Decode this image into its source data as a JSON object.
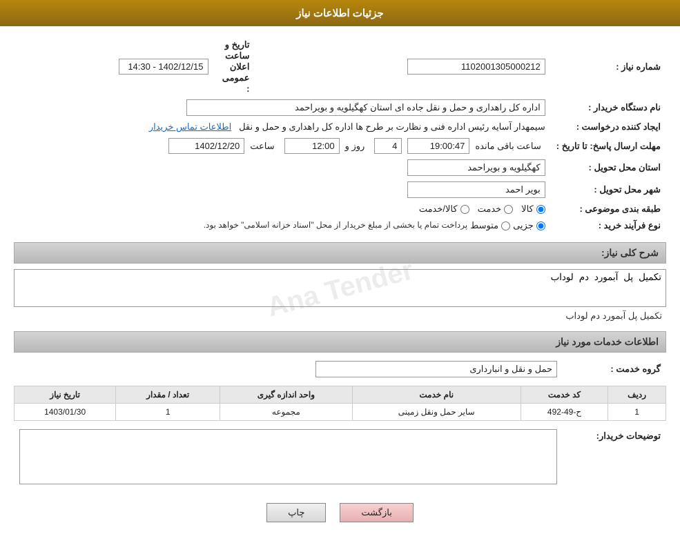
{
  "header": {
    "title": "جزئیات اطلاعات نیاز"
  },
  "fields": {
    "shomara_niaz_label": "شماره نیاز :",
    "shomara_niaz_value": "1102001305000212",
    "name_dastgah_label": "نام دستگاه خریدار :",
    "name_dastgah_value": "اداره کل راهداری و حمل و نقل جاده ای استان کهگیلویه و بویراحمد",
    "ijad_konande_label": "ایجاد کننده درخواست :",
    "ijad_konande_value": "سیمهدار آسایه رئیس اداره فنی و نظارت بر طرح ها اداره کل راهداری و حمل و نقل",
    "ijad_konande_link": "اطلاعات تماس خریدار",
    "mohlat_label": "مهلت ارسال پاسخ: تا تاریخ :",
    "tarikh_value": "1402/12/20",
    "saat_label": "ساعت",
    "saat_value": "12:00",
    "roz_label": "روز و",
    "roz_value": "4",
    "mande_label": "ساعت باقی مانده",
    "mande_value": "19:00:47",
    "ostan_label": "استان محل تحویل :",
    "ostan_value": "کهگیلویه و بویراحمد",
    "shahr_label": "شهر محل تحویل :",
    "shahr_value": "بویر احمد",
    "tabaqe_label": "طبقه بندی موضوعی :",
    "radio_kala": "کالا",
    "radio_khedmat": "خدمت",
    "radio_kala_khedmat": "کالا/خدمت",
    "nooe_farayand_label": "نوع فرآیند خرید :",
    "radio_jazzi": "جزیی",
    "radio_motavasset": "متوسط",
    "radio_text": "پرداخت تمام یا بخشی از مبلغ خریدار از محل \"اسناد خزانه اسلامی\" خواهد بود.",
    "tarikh_elan_label": "تاریخ و ساعت اعلان عمومی :",
    "tarikh_elan_value": "1402/12/15 - 14:30",
    "sharh_label": "شرح کلی نیاز:",
    "sharh_value": "تکمیل پل آبمورد دم لوداب",
    "khadamat_label": "اطلاعات خدمات مورد نیاز",
    "gorooh_label": "گروه خدمت :",
    "gorooh_value": "حمل و نقل و انبارداری",
    "table": {
      "headers": [
        "ردیف",
        "کد خدمت",
        "نام خدمت",
        "واحد اندازه گیری",
        "تعداد / مقدار",
        "تاریخ نیاز"
      ],
      "rows": [
        {
          "radif": "1",
          "kod": "ح-49-492",
          "name": "سایر حمل ونقل زمینی",
          "vahed": "مجموعه",
          "tedad": "1",
          "tarikh": "1403/01/30"
        }
      ]
    },
    "buyer_desc_label": "توضیحات خریدار:"
  },
  "buttons": {
    "print": "چاپ",
    "back": "بازگشت"
  }
}
